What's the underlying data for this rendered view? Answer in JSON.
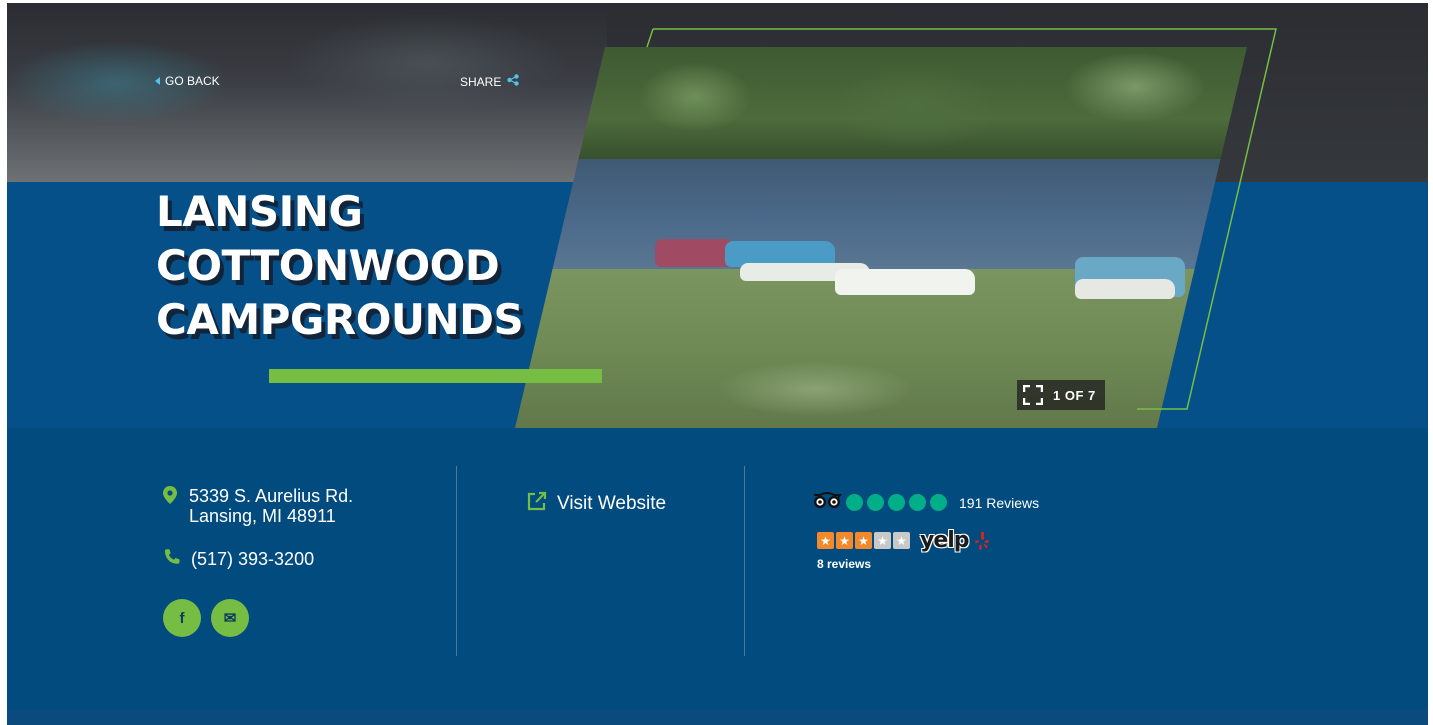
{
  "hero": {
    "go_back_label": "GO BACK",
    "share_label": "SHARE",
    "title_lines": [
      "LANSING",
      "COTTONWOOD",
      "CAMPGROUNDS"
    ],
    "gallery": {
      "current": 1,
      "total": 7,
      "counter_text": "1 OF 7"
    }
  },
  "info": {
    "address_line1": "5339 S. Aurelius Rd.",
    "address_line2": "Lansing, MI 48911",
    "phone": "(517) 393-3200",
    "social": [
      {
        "name": "facebook",
        "icon": "facebook-icon",
        "glyph": "f"
      },
      {
        "name": "email",
        "icon": "envelope-icon",
        "glyph": "✉"
      }
    ],
    "website_label": "Visit Website",
    "tripadvisor": {
      "rating": 5,
      "max": 5,
      "reviews_text": "191 Reviews"
    },
    "yelp": {
      "rating": 3,
      "max": 5,
      "reviews_text": "8 reviews",
      "logo_text": "yelp"
    }
  },
  "colors": {
    "band_blue": "#055088",
    "info_blue": "#014b7f",
    "accent_green": "#76bd43",
    "tripadvisor_green": "#00af87",
    "yelp_orange": "#f28a2b"
  }
}
